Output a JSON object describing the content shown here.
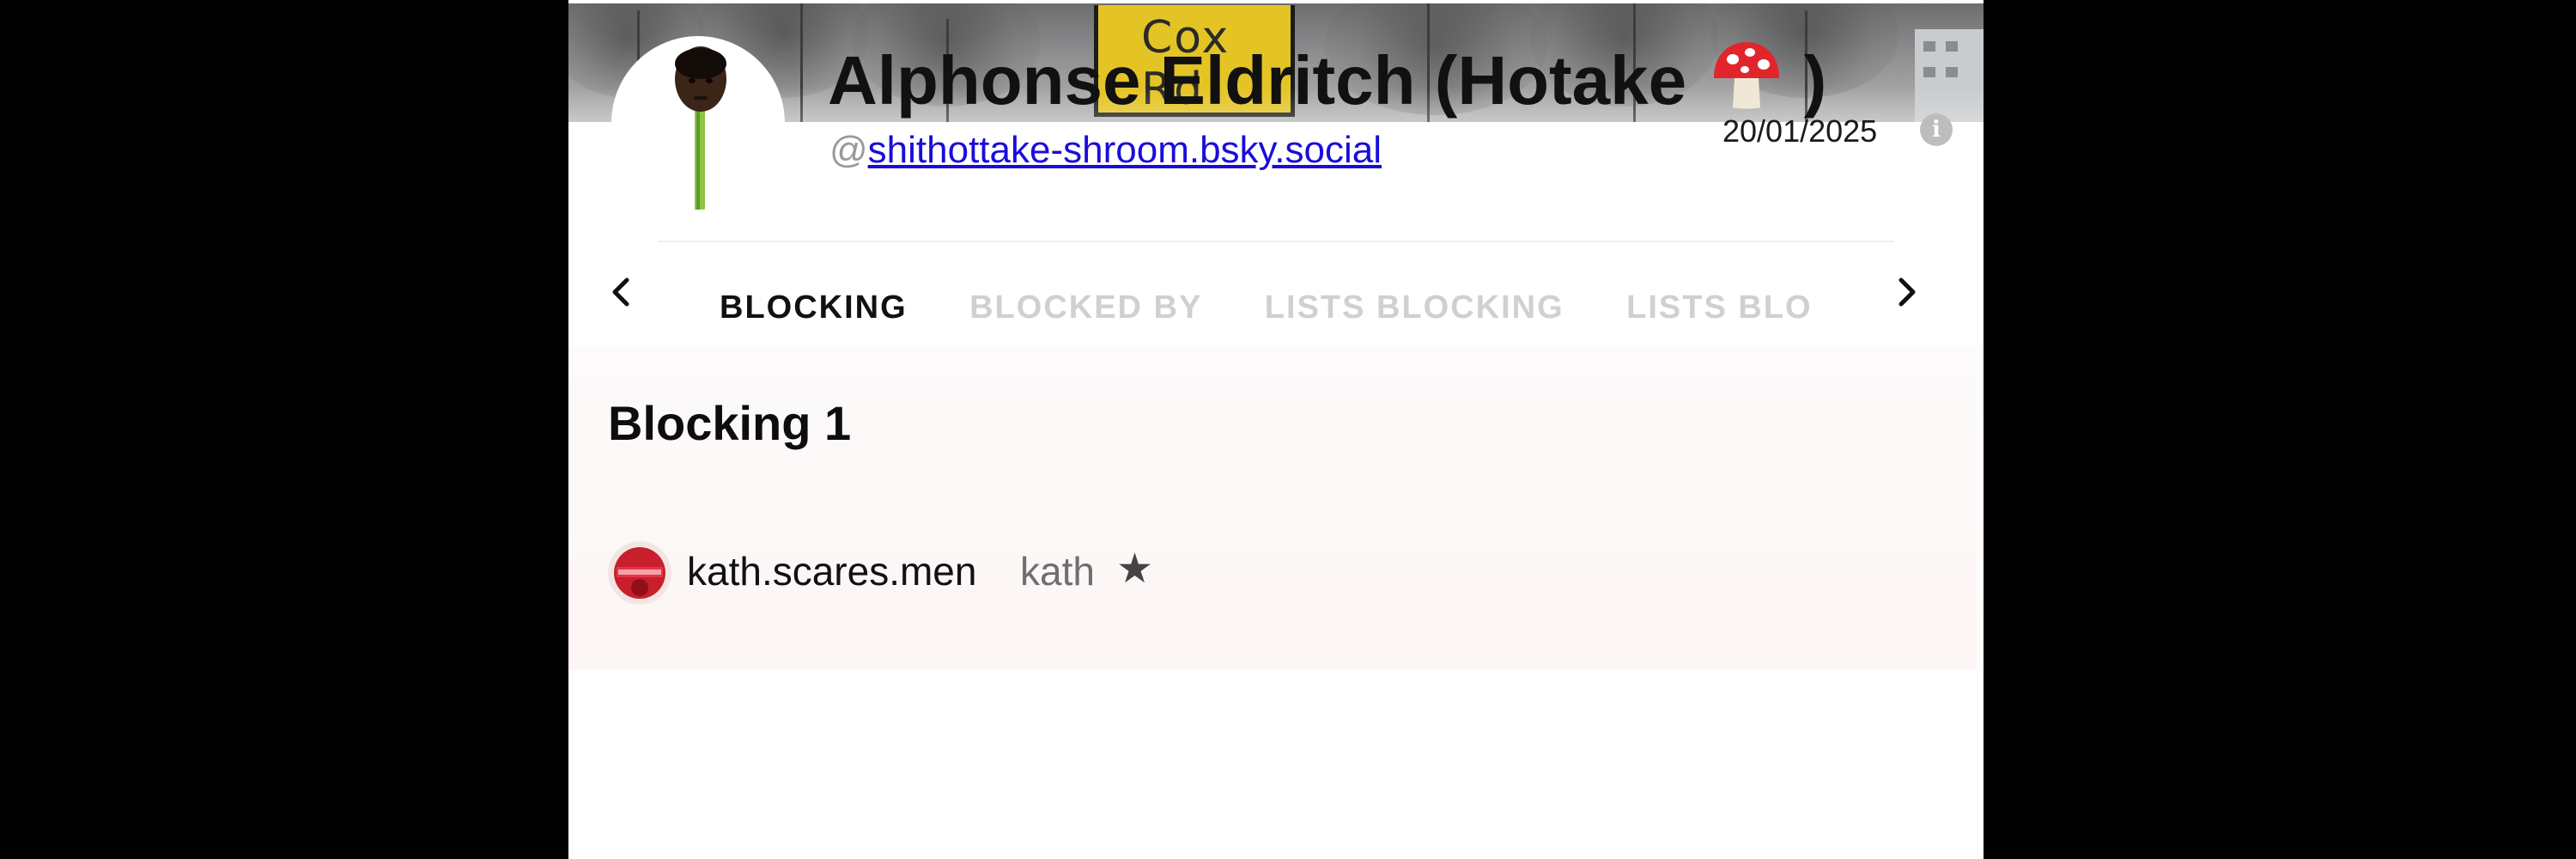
{
  "profile": {
    "display_name": "Alphonse Eldritch (Hotake",
    "display_name_close": ")",
    "name_emoji_icon": "mushroom-icon",
    "handle_prefix": "@",
    "handle": "shithottake-shroom.bsky.social",
    "date": "20/01/2025",
    "info_icon": "i",
    "banner_sign_text": "Cox Rd"
  },
  "tabs": {
    "prev_icon": "chevron-left-icon",
    "next_icon": "chevron-right-icon",
    "items": [
      {
        "label": "BLOCKING",
        "active": true
      },
      {
        "label": "BLOCKED BY",
        "active": false
      },
      {
        "label": "LISTS BLOCKING",
        "active": false
      },
      {
        "label": "LISTS BLOCKED BY",
        "active": false
      }
    ]
  },
  "section": {
    "title": "Blocking 1"
  },
  "blocking_list": [
    {
      "handle": "kath.scares.men",
      "name": "kath",
      "star": "★"
    }
  ],
  "colors": {
    "page_background": "#000000",
    "link": "#1a0dd9",
    "active_tab": "#111111",
    "inactive_tab": "#d0d0d0",
    "sign_yellow": "#e4c425",
    "mushroom_red": "#e0262b"
  }
}
